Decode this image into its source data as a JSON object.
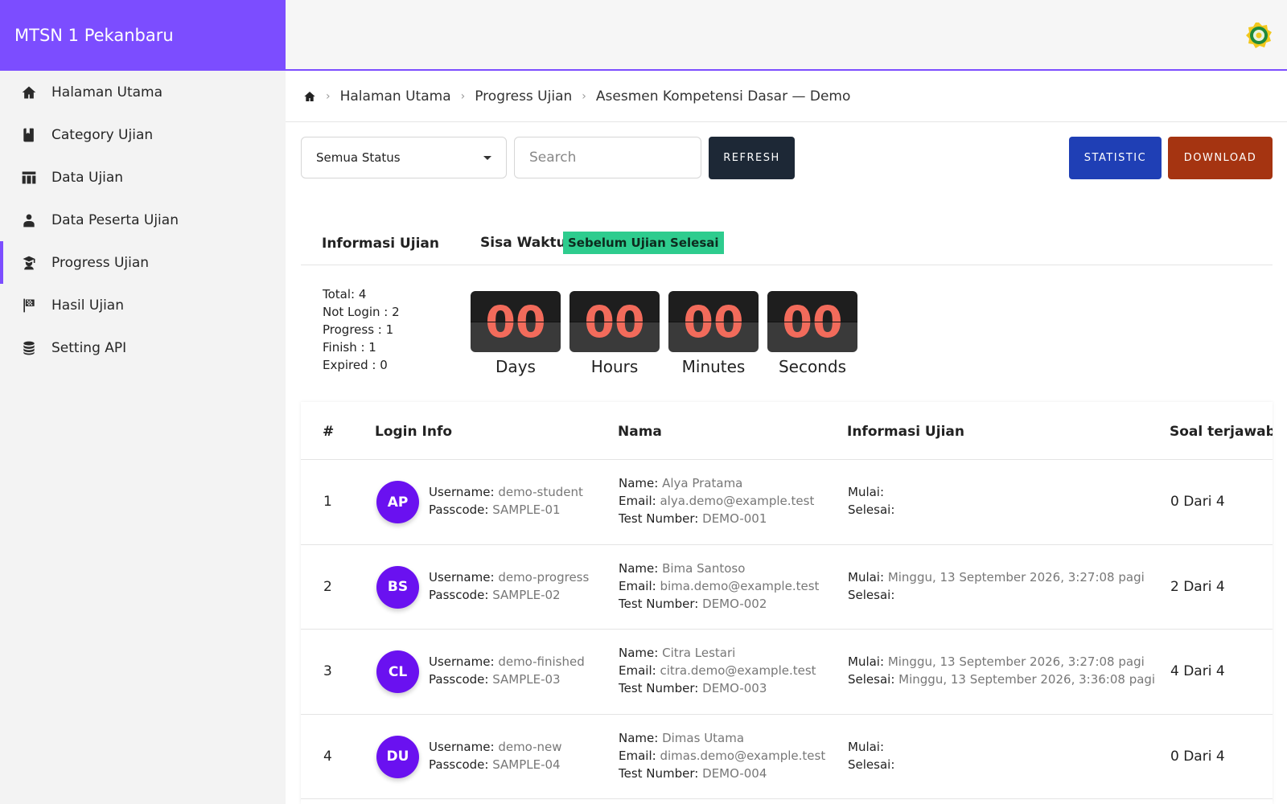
{
  "app": {
    "brand": "MTSN 1 Pekanbaru"
  },
  "sidebar": {
    "items": [
      {
        "label": "Halaman Utama",
        "icon": "home-icon"
      },
      {
        "label": "Category Ujian",
        "icon": "book-icon"
      },
      {
        "label": "Data Ujian",
        "icon": "table-icon"
      },
      {
        "label": "Data Peserta Ujian",
        "icon": "person-icon"
      },
      {
        "label": "Progress Ujian",
        "icon": "student-icon",
        "active": true
      },
      {
        "label": "Hasil Ujian",
        "icon": "flag-icon"
      },
      {
        "label": "Setting API",
        "icon": "database-icon"
      }
    ]
  },
  "breadcrumb": {
    "items": [
      "Halaman Utama",
      "Progress Ujian",
      "Asesmen Kompetensi Dasar — Demo"
    ]
  },
  "toolbar": {
    "status_value": "Semua Status",
    "search_placeholder": "Search",
    "refresh_label": "REFRESH",
    "statistic_label": "STATISTIC",
    "download_label": "DOWNLOAD"
  },
  "info": {
    "title": "Informasi Ujian",
    "sisa_label": "Sisa Waktu:",
    "sisa_badge": "Sebelum Ujian Selesai",
    "stats": [
      "Total: 4",
      "Not Login : 2",
      "Progress : 1",
      "Finish : 1",
      "Expired : 0"
    ]
  },
  "countdown": [
    {
      "value": "00",
      "label": "Days"
    },
    {
      "value": "00",
      "label": "Hours"
    },
    {
      "value": "00",
      "label": "Minutes"
    },
    {
      "value": "00",
      "label": "Seconds"
    }
  ],
  "table": {
    "headers": [
      "#",
      "Login Info",
      "Nama",
      "Informasi Ujian",
      "Soal terjawab"
    ],
    "labels": {
      "username": "Username:",
      "passcode": "Passcode:",
      "name": "Name:",
      "email": "Email:",
      "test_number": "Test Number:",
      "mulai": "Mulai:",
      "selesai": "Selesai:"
    },
    "rows": [
      {
        "no": "1",
        "initials": "AP",
        "username": "demo-student",
        "passcode": "SAMPLE-01",
        "name": "Alya Pratama",
        "email": "alya.demo@example.test",
        "test_number": "DEMO-001",
        "mulai": "",
        "selesai": "",
        "soal": "0 Dari 4"
      },
      {
        "no": "2",
        "initials": "BS",
        "username": "demo-progress",
        "passcode": "SAMPLE-02",
        "name": "Bima Santoso",
        "email": "bima.demo@example.test",
        "test_number": "DEMO-002",
        "mulai": "Minggu, 13 September 2026, 3:27:08 pagi",
        "selesai": "",
        "soal": "2 Dari 4"
      },
      {
        "no": "3",
        "initials": "CL",
        "username": "demo-finished",
        "passcode": "SAMPLE-03",
        "name": "Citra Lestari",
        "email": "citra.demo@example.test",
        "test_number": "DEMO-003",
        "mulai": "Minggu, 13 September 2026, 3:27:08 pagi",
        "selesai": "Minggu, 13 September 2026, 3:36:08 pagi",
        "soal": "4 Dari 4"
      },
      {
        "no": "4",
        "initials": "DU",
        "username": "demo-new",
        "passcode": "SAMPLE-04",
        "name": "Dimas Utama",
        "email": "dimas.demo@example.test",
        "test_number": "DEMO-004",
        "mulai": "",
        "selesai": "",
        "soal": "0 Dari 4"
      }
    ]
  },
  "colors": {
    "accent": "#7c4dff",
    "avatar": "#6a11f0",
    "refresh": "#1d2836",
    "statistic": "#1f3fb5",
    "download": "#a53411",
    "badge": "#2ecc8e",
    "countdown_digits": "#f26b5b"
  }
}
